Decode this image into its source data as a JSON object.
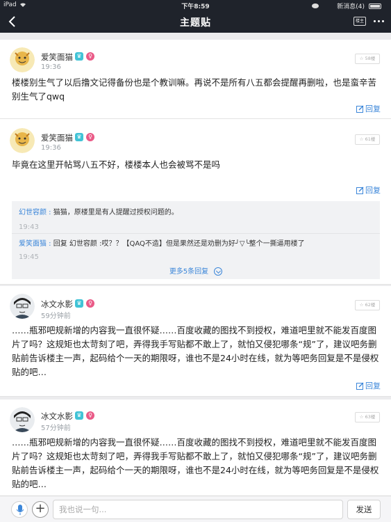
{
  "status_bar": {
    "device": "iPad",
    "time": "下午8:59",
    "notification": "新消息(4)"
  },
  "nav": {
    "title": "主题贴",
    "owner_only_label": "楼主",
    "back_icon": "chevron-left-icon",
    "more_icon": "ellipsis-icon"
  },
  "posts": [
    {
      "author": "爱笑面猫",
      "time": "19:36",
      "floor": "58楼",
      "text": "楼楼别生气了以后撸文记得备份也是个教训嘛。再说不是所有八五都会提醒再删啦，也是蛮辛苦别生气了qwq",
      "reply_label": "回复"
    },
    {
      "author": "爱笑面猫",
      "time": "19:36",
      "floor": "61楼",
      "text": "毕竟在这里开帖骂八五不好，楼楼本人也会被骂不是吗",
      "reply_label": "回复",
      "sub_replies": [
        {
          "author": "幻世容颜",
          "text": "猫猫，原楼里是有人提醒过授权问题的。",
          "time": "19:43"
        },
        {
          "author": "爱笑面猫",
          "text": "回复 幻世容颜 :哎？？【QAQ不造】但是果然还是劝删为好╯▽╰整个一撕逼用楼了",
          "time": "19:45"
        }
      ],
      "more_replies": "更多5条回复"
    },
    {
      "author": "冰文水影",
      "time": "59分钟前",
      "floor": "62楼",
      "text": "……瓶邪吧规新增的内容我一直很怀疑……百度收藏的图找不到授权，难道吧里就不能发百度图片了吗？这规矩也太苛刻了吧，弄得我手写贴都不敢上了，就怕又侵犯哪条“规”了，建议吧务删贴前告诉楼主一声，起码给个一天的期限呀，谁也不是24小时在线，就为等吧务回复是不是侵权贴的吧…",
      "reply_label": "回复"
    },
    {
      "author": "冰文水影",
      "time": "57分钟前",
      "floor": "63楼",
      "text": "……瓶邪吧规新增的内容我一直很怀疑……百度收藏的图找不到授权，难道吧里就不能发百度图片了吗？这规矩也太苛刻了吧，弄得我手写贴都不敢上了，就怕又侵犯哪条“规”了，建议吧务删贴前告诉楼主一声，起码给个一天的期限呀，谁也不是24小时在线，就为等吧务回复是不是侵权贴的吧…",
      "reply_label": "回复"
    }
  ],
  "composer": {
    "placeholder": "我也说一句...",
    "send_label": "发送"
  },
  "colors": {
    "nav_bg": "#1f232b",
    "link": "#3b86d9",
    "level_badge": "#41c3d6",
    "gender_badge": "#ea5a87"
  }
}
